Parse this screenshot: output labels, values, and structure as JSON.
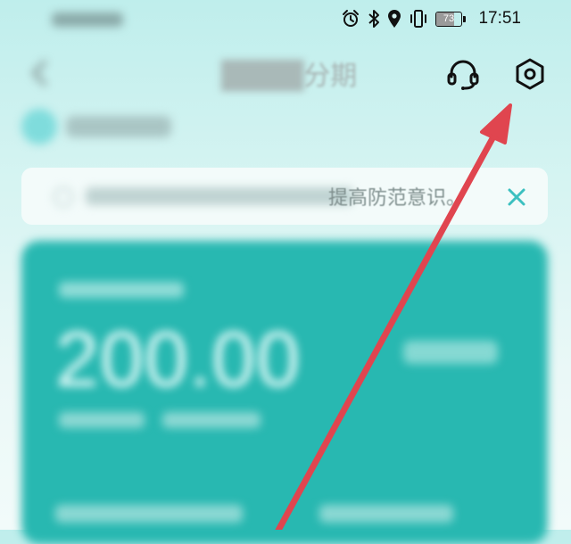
{
  "status_bar": {
    "battery_level": "73",
    "battery_fraction": 0.73,
    "time": "17:51",
    "icons": [
      "alarm-icon",
      "bluetooth-icon",
      "location-icon",
      "vibrate-icon",
      "battery-icon"
    ]
  },
  "header": {
    "title_suffix": "分期",
    "icons": [
      "back-icon",
      "headset-icon",
      "settings-icon"
    ]
  },
  "notice": {
    "text": "提高防范意识。",
    "close_icon": "close-icon"
  },
  "card": {
    "amount": "200.00"
  },
  "annotation": {
    "color": "#e0454f"
  },
  "colors": {
    "accent": "#28b8b1",
    "notice_close": "#3cc0c0"
  }
}
